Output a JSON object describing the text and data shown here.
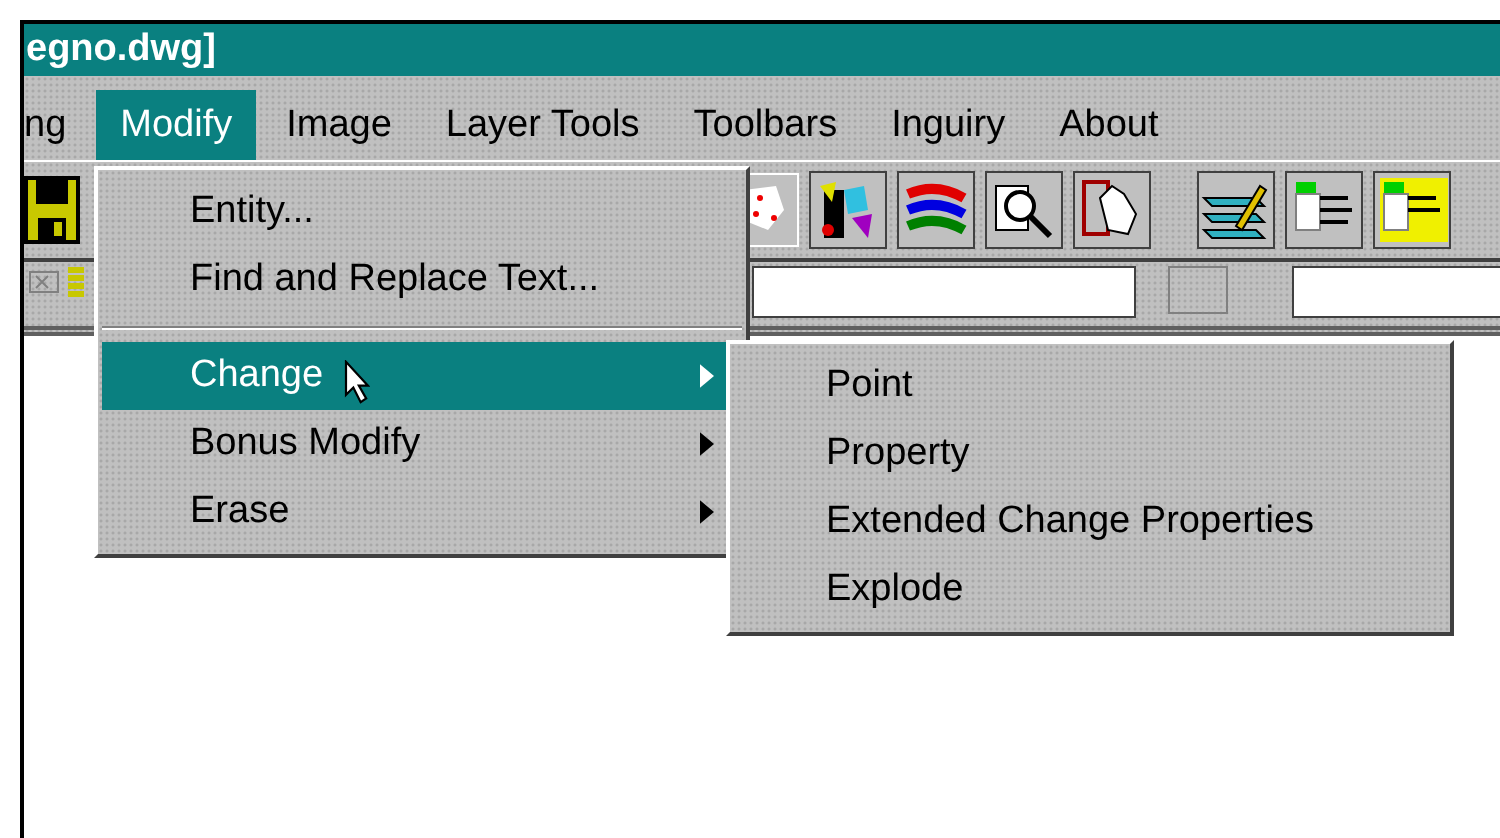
{
  "window": {
    "title": "egno.dwg]"
  },
  "menu_bar": [
    {
      "label": "ng",
      "selected": false
    },
    {
      "label": "Modify",
      "selected": true
    },
    {
      "label": "Image",
      "selected": false
    },
    {
      "label": "Layer Tools",
      "selected": false
    },
    {
      "label": "Toolbars",
      "selected": false
    },
    {
      "label": "Inguiry",
      "selected": false
    },
    {
      "label": "About",
      "selected": false
    }
  ],
  "modify_menu": {
    "items": [
      {
        "kind": "item",
        "label": "Entity...",
        "has_submenu": false,
        "selected": false
      },
      {
        "kind": "item",
        "label": "Find and Replace Text...",
        "has_submenu": false,
        "selected": false
      },
      {
        "kind": "separator"
      },
      {
        "kind": "item",
        "label": "Change",
        "has_submenu": true,
        "selected": true
      },
      {
        "kind": "item",
        "label": "Bonus Modify",
        "has_submenu": true,
        "selected": false
      },
      {
        "kind": "item",
        "label": "Erase",
        "has_submenu": true,
        "selected": false
      }
    ]
  },
  "change_submenu": {
    "items": [
      {
        "label": "Point"
      },
      {
        "label": "Property"
      },
      {
        "label": "Extended Change Properties"
      },
      {
        "label": "Explode"
      }
    ]
  }
}
